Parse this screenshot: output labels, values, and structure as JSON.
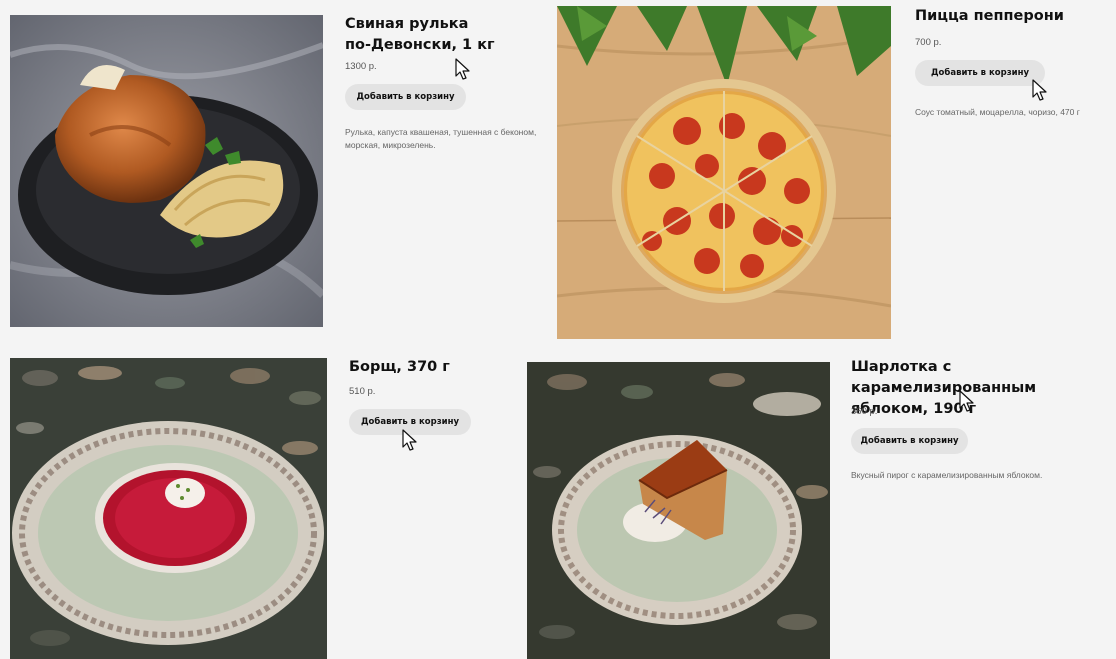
{
  "products": [
    {
      "title_line1": "Свиная рулька",
      "title_line2": "по-Девонски, 1 кг",
      "price": "1300 р.",
      "button_label": "Добавить в корзину",
      "description_line1": "Рулька, капуста квашеная, тушенная с беконом,",
      "description_line2": "морская, микрозелень."
    },
    {
      "title": "Пицца пепперони",
      "price": "700 р.",
      "button_label": "Добавить в корзину",
      "description": "Соус томатный, моцарелла, чоризо, 470 г"
    },
    {
      "title": "Борщ, 370 г",
      "price": "510 р.",
      "button_label": "Добавить в корзину"
    },
    {
      "title_line1": "Шарлотка с карамелизированным",
      "title_line2": "яблоком, 190 г",
      "price": "360 р.",
      "button_label": "Добавить в корзину",
      "description": "Вкусный пирог с карамелизированным яблоком."
    }
  ]
}
